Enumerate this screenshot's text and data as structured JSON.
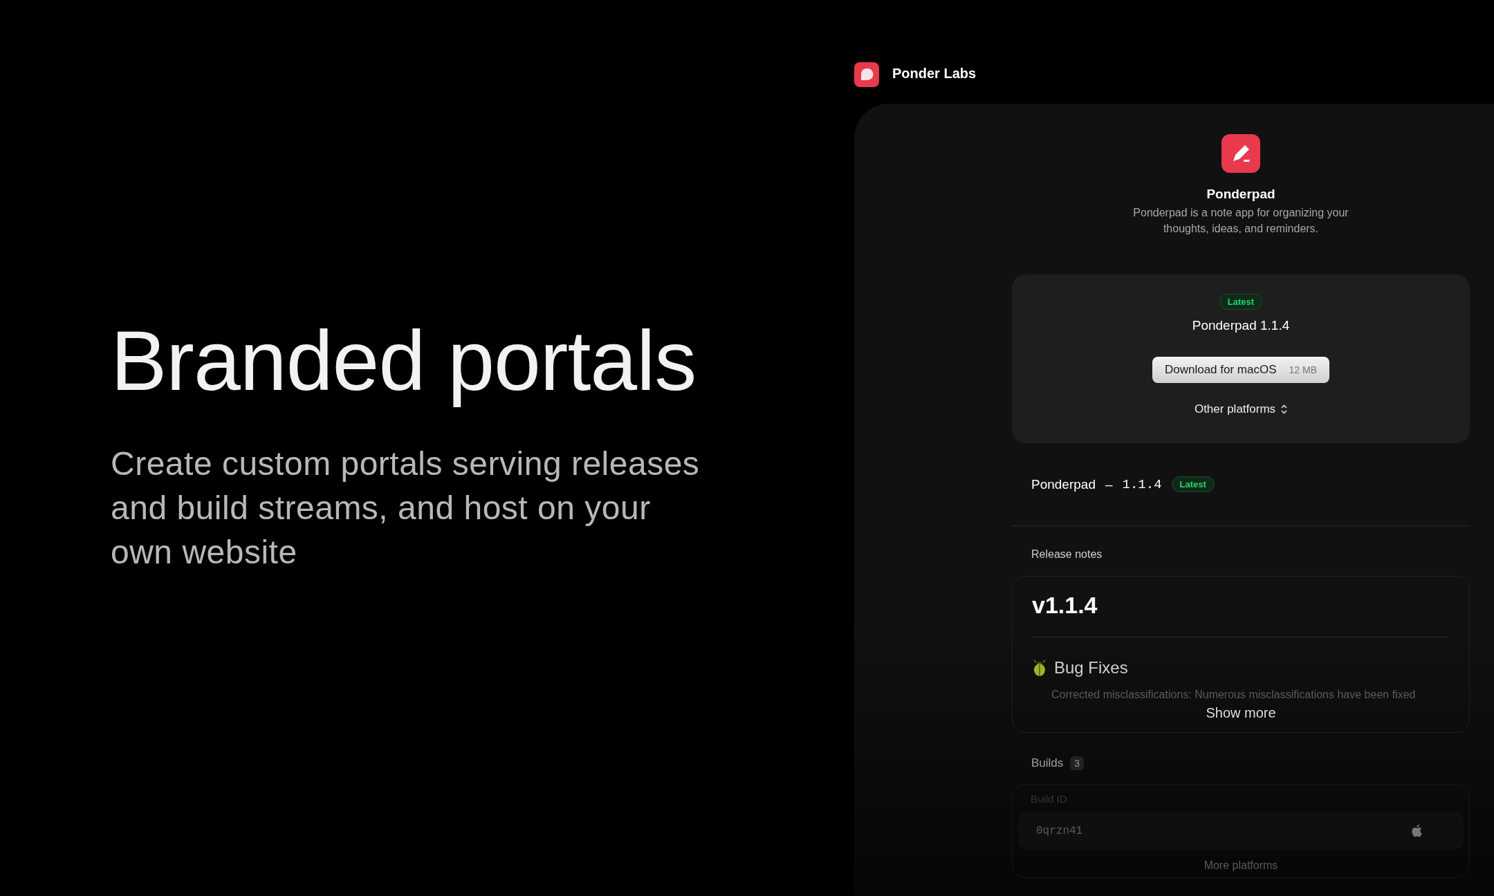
{
  "hero": {
    "title": "Branded portals",
    "subtitle": "Create custom portals serving releases and build streams, and host on your own website"
  },
  "brand": {
    "name": "Ponder Labs"
  },
  "app": {
    "name": "Ponderpad",
    "description": "Ponderpad is a note app for organizing your thoughts, ideas, and reminders."
  },
  "download_card": {
    "badge": "Latest",
    "release": "Ponderpad 1.1.4",
    "button": {
      "label": "Download for macOS",
      "size": "12 MB"
    },
    "other_platforms": "Other platforms"
  },
  "release": {
    "app": "Ponderpad",
    "separator": "–",
    "version": "1.1.4",
    "badge": "Latest"
  },
  "release_notes": {
    "heading": "Release notes",
    "version_title": "v1.1.4",
    "section": "Bug Fixes",
    "faded_text": "Corrected misclassifications: Numerous misclassifications have been fixed",
    "show_more": "Show more"
  },
  "builds": {
    "heading": "Builds",
    "count": "3",
    "column": "Build ID",
    "rows": [
      {
        "id": "0qrzn41"
      }
    ],
    "more_platforms": "More platforms"
  }
}
